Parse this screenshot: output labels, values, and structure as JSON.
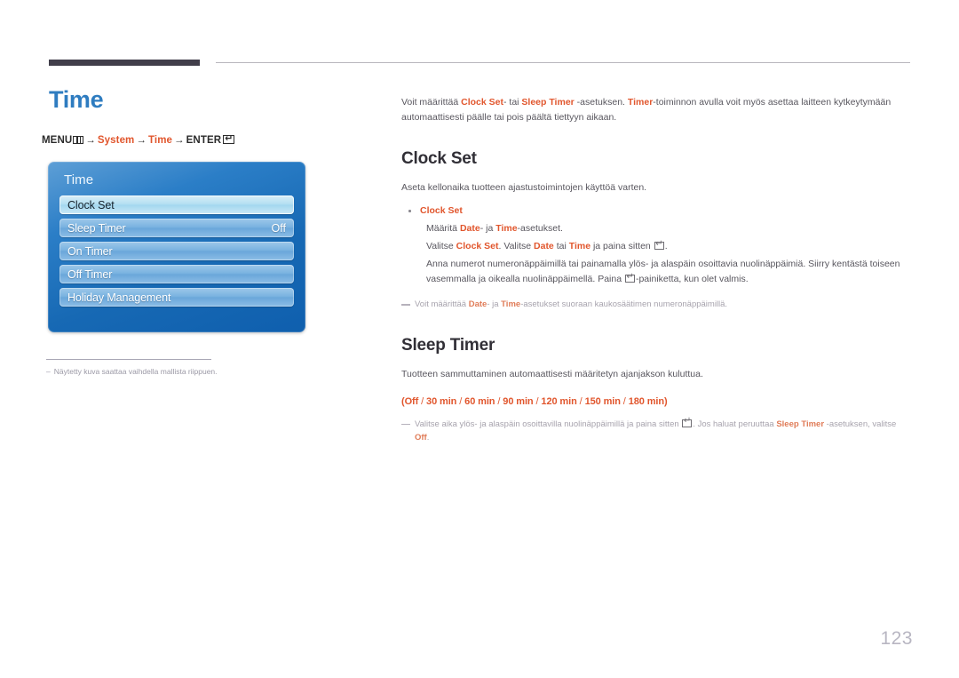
{
  "page": {
    "title": "Time",
    "number": "123",
    "menu_path": {
      "menu_label": "MENU",
      "arrow": "→",
      "steps": [
        "System",
        "Time"
      ],
      "enter_label": "ENTER"
    }
  },
  "osd": {
    "title": "Time",
    "items": [
      {
        "label": "Clock Set",
        "value": "",
        "selected": true
      },
      {
        "label": "Sleep Timer",
        "value": "Off",
        "selected": false
      },
      {
        "label": "On Timer",
        "value": "",
        "selected": false
      },
      {
        "label": "Off Timer",
        "value": "",
        "selected": false
      },
      {
        "label": "Holiday Management",
        "value": "",
        "selected": false
      }
    ]
  },
  "footnote": {
    "dash": "–",
    "text": "Näytetty kuva saattaa vaihdella mallista riippuen."
  },
  "intro": {
    "p1_a": "Voit määrittää ",
    "p1_b": "Clock Set",
    "p1_c": "- tai ",
    "p1_d": "Sleep Timer",
    "p1_e": " -asetuksen. ",
    "p1_f": "Timer",
    "p1_g": "-toiminnon avulla voit myös asettaa laitteen kytkeytymään automaattisesti päälle tai pois päältä tiettyyn aikaan."
  },
  "clock_set": {
    "heading": "Clock Set",
    "lead": "Aseta kellonaika tuotteen ajastustoimintojen käyttöä varten.",
    "bullet_title": "Clock Set",
    "line1_a": "Määritä ",
    "line1_b": "Date",
    "line1_c": "- ja ",
    "line1_d": "Time",
    "line1_e": "-asetukset.",
    "line2_a": "Valitse ",
    "line2_b": "Clock Set",
    "line2_c": ". Valitse ",
    "line2_d": "Date",
    "line2_e": " tai ",
    "line2_f": "Time",
    "line2_g": " ja paina sitten ",
    "line2_h": ".",
    "line3": "Anna numerot numeronäppäimillä tai painamalla ylös- ja alaspäin osoittavia nuolinäppäimiä. Siirry kentästä toiseen vasemmalla ja oikealla nuolinäppäimellä. Paina ",
    "line3_b": "-painiketta, kun olet valmis.",
    "note_a": "Voit määrittää ",
    "note_b": "Date",
    "note_c": "- ja ",
    "note_d": "Time",
    "note_e": "-asetukset suoraan kaukosäätimen numeronäppäimillä."
  },
  "sleep_timer": {
    "heading": "Sleep Timer",
    "lead": "Tuotteen sammuttaminen automaattisesti määritetyn ajanjakson kuluttua.",
    "options_open": "(",
    "options": [
      "Off",
      "30 min",
      "60 min",
      "90 min",
      "120 min",
      "150 min",
      "180 min"
    ],
    "options_close": ")",
    "note_a": "Valitse aika ylös- ja alaspäin osoittavilla nuolinäppäimillä ja paina sitten ",
    "note_b": ". Jos haluat peruuttaa ",
    "note_c": "Sleep Timer",
    "note_d": " -asetuksen, valitse ",
    "note_e": "Off",
    "note_f": "."
  },
  "colors": {
    "accent_blue": "#2e7cc0",
    "accent_orange": "#e1562d",
    "rule_dark": "#413e4a",
    "body_text": "#58565e",
    "page_number": "#b8b6c2"
  }
}
